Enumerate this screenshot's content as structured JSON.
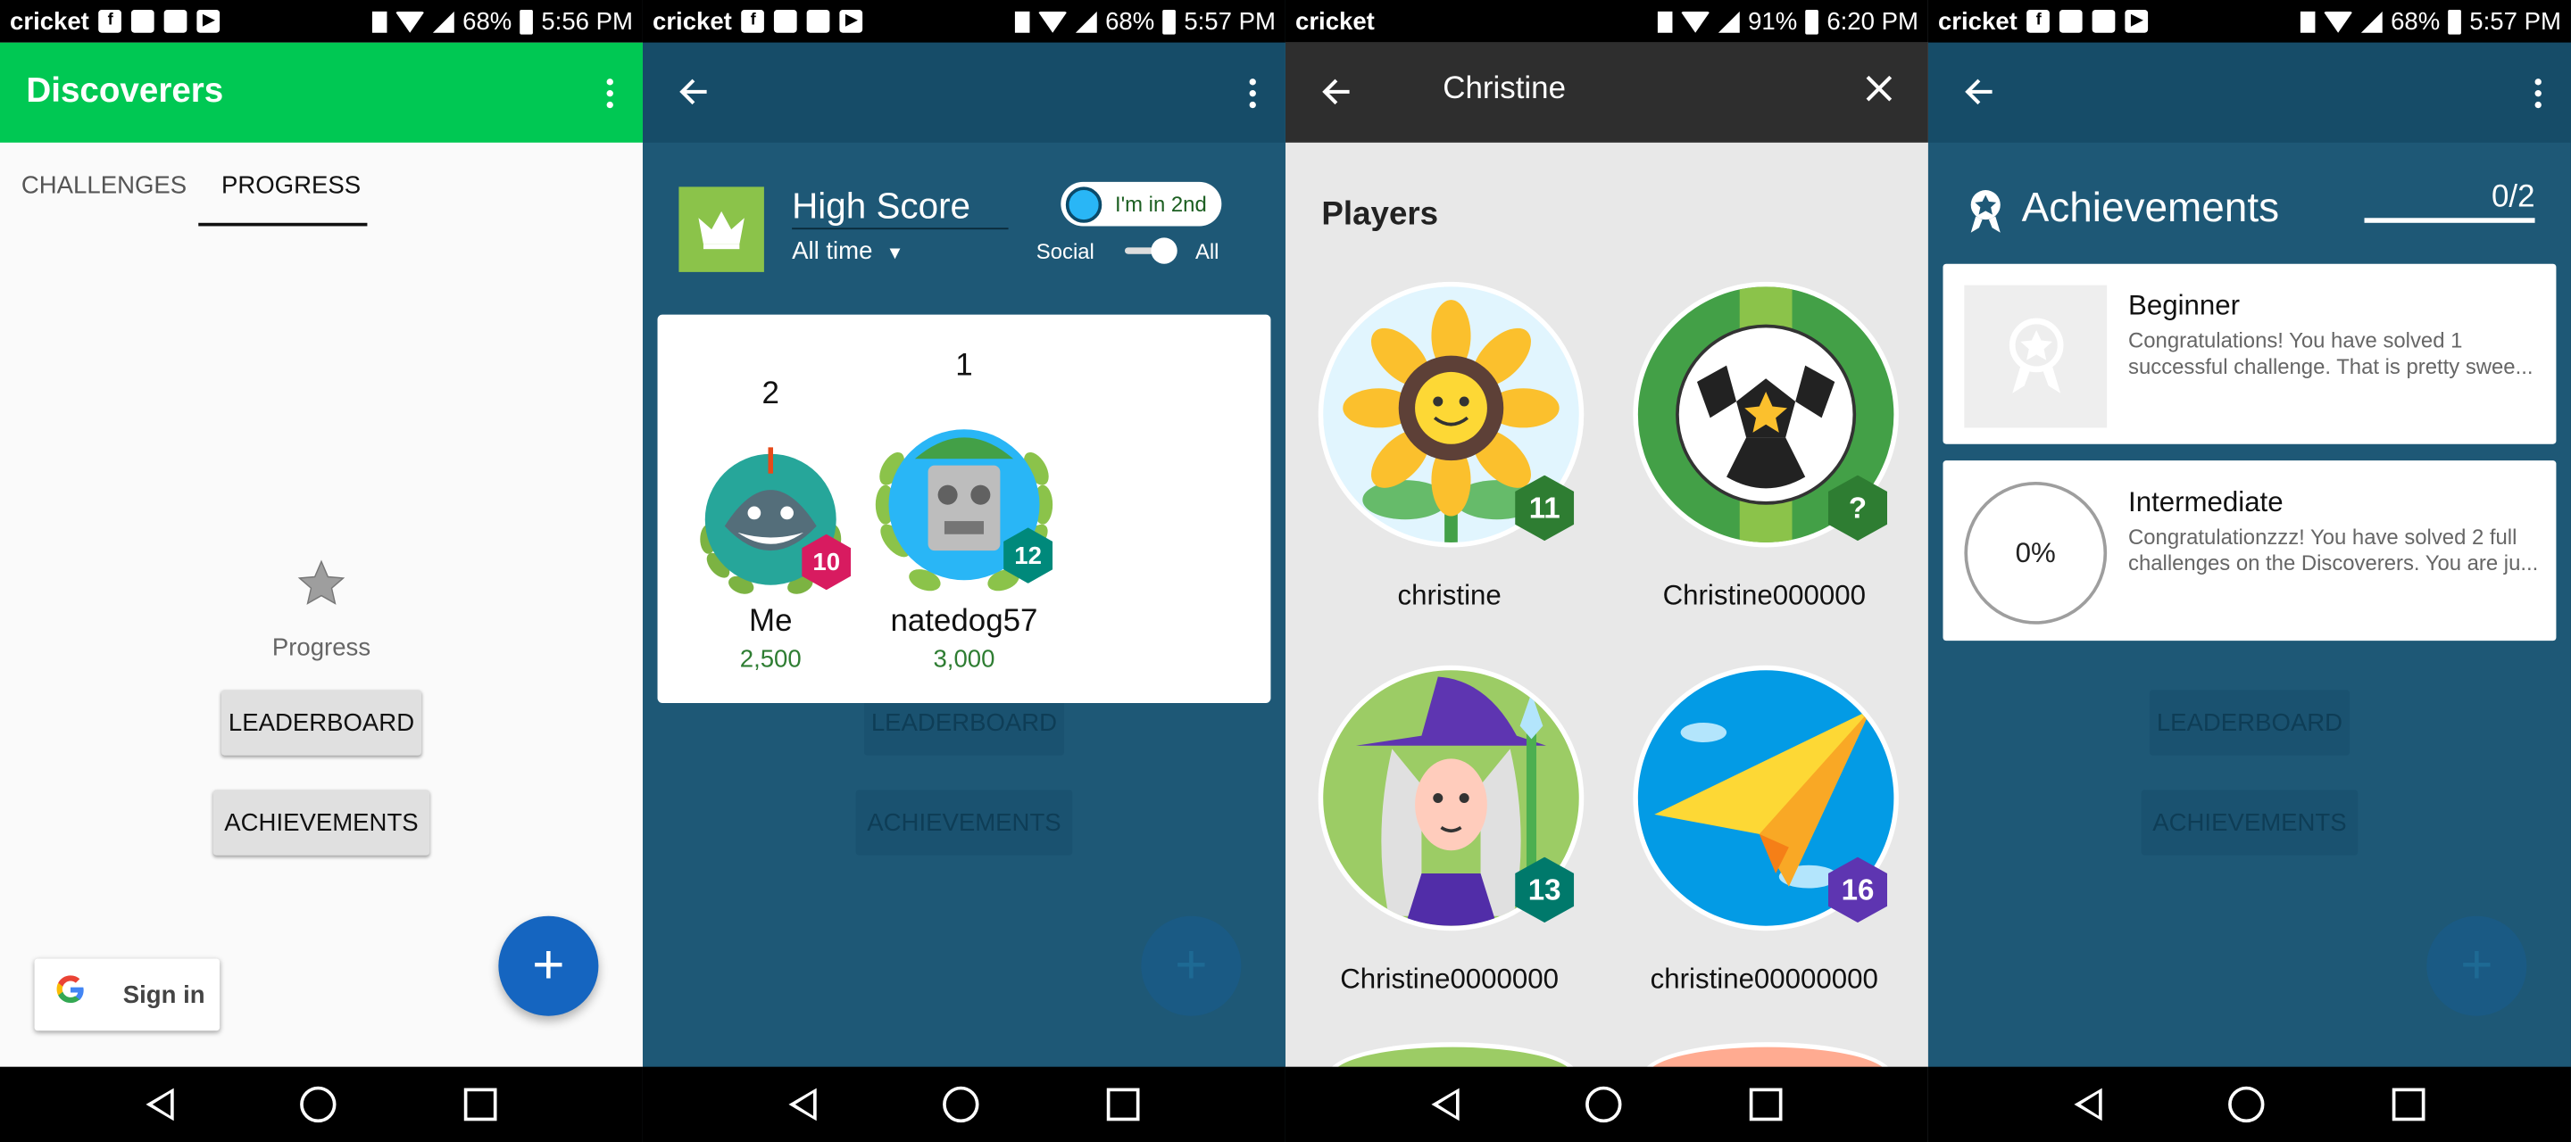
{
  "status_bars": [
    {
      "carrier": "cricket",
      "battery": "68%",
      "time": "5:56 PM"
    },
    {
      "carrier": "cricket",
      "battery": "68%",
      "time": "5:57 PM"
    },
    {
      "carrier": "cricket",
      "battery": "91%",
      "time": "6:20 PM"
    },
    {
      "carrier": "cricket",
      "battery": "68%",
      "time": "5:57 PM"
    }
  ],
  "screen1": {
    "app_title": "Discoverers",
    "tabs": [
      "CHALLENGES",
      "PROGRESS"
    ],
    "active_tab": "PROGRESS",
    "progress_label": "Progress",
    "leaderboard_button": "LEADERBOARD",
    "achievements_button": "ACHIEVEMENTS",
    "sign_in": "Sign in",
    "fab_icon": "+"
  },
  "screen2": {
    "title": "High Score",
    "time_filter": "All time",
    "rank_badge": "I'm in 2nd",
    "toggle_left": "Social",
    "toggle_right": "All",
    "players": [
      {
        "rank": "2",
        "name": "Me",
        "score": "2,500",
        "level": "10",
        "level_color": "#d81b60"
      },
      {
        "rank": "1",
        "name": "natedog57",
        "score": "3,000",
        "level": "12",
        "level_color": "#00897b"
      }
    ]
  },
  "screen3": {
    "search_query": "Christine",
    "section_title": "Players",
    "players": [
      {
        "name": "christine",
        "level": "11",
        "level_color": "#2e7d32"
      },
      {
        "name": "Christine000000",
        "level": "?",
        "level_color": "#2e7d32"
      },
      {
        "name": "Christine0000000",
        "level": "13",
        "level_color": "#00796b"
      },
      {
        "name": "christine00000000",
        "level": "16",
        "level_color": "#5e35b1"
      }
    ]
  },
  "screen4": {
    "title": "Achievements",
    "count": "0/2",
    "progress_fraction": 0,
    "items": [
      {
        "name": "Beginner",
        "description": "Congratulations! You have solved 1 successful challenge. That is pretty swee..."
      },
      {
        "name": "Intermediate",
        "description": "Congratulationzzz! You have solved 2 full challenges on the Discoverers. You are ju...",
        "percent": "0%"
      }
    ]
  }
}
